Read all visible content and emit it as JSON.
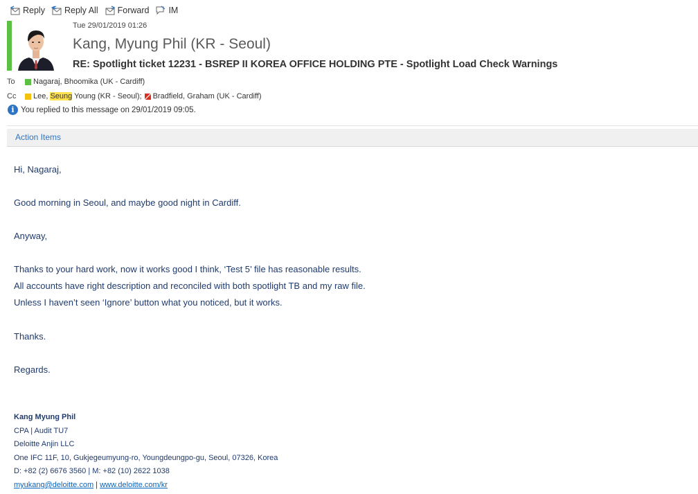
{
  "toolbar": {
    "reply": "Reply",
    "reply_all": "Reply All",
    "forward": "Forward",
    "im": "IM"
  },
  "message": {
    "date": "Tue 29/01/2019 01:26",
    "sender": "Kang, Myung Phil (KR - Seoul)",
    "subject": "RE: Spotlight ticket 12231 - BSREP II KOREA OFFICE HOLDING PTE - Spotlight Load Check Warnings",
    "to_label": "To",
    "to": [
      {
        "name": "Nagaraj, Bhoomika (UK - Cardiff)",
        "presence_color": "#5cc044"
      }
    ],
    "cc_label": "Cc",
    "cc": [
      {
        "name_before": "Lee, ",
        "name_highlight": "Seung",
        "name_after": " Young (KR - Seoul);",
        "presence_color": "#f4c20d"
      },
      {
        "name": "Bradfield, Graham (UK - Cardiff)",
        "presence_color": "#d93025"
      }
    ],
    "info": "You replied to this message on 29/01/2019 09:05."
  },
  "action_items": "Action Items",
  "body": {
    "lines": [
      "Hi, Nagaraj,",
      "Good morning in Seoul, and maybe good night in Cardiff.",
      "Anyway,",
      "Thanks to your hard work, now it works good I think, ‘Test 5’ file has reasonable results.",
      "All accounts have right description and reconciled with both spotlight TB and my raw file.",
      "Unless I haven’t seen ‘Ignore’ button what you noticed, but it works.",
      "Thanks.",
      "Regards."
    ]
  },
  "signature": {
    "name": "Kang Myung Phil",
    "title": "CPA | Audit TU7",
    "company": "Deloitte Anjin LLC",
    "address": "One IFC 11F, 10, Gukjegeumyung-ro, Youngdeungpo-gu, Seoul, 07326, Korea",
    "phones": "D: +82 (2) 6676 3560 | M: +82 (10) 2622 1038",
    "email": "myukang@deloitte.com",
    "separator": "|",
    "website": "www.deloitte.com/kr"
  }
}
